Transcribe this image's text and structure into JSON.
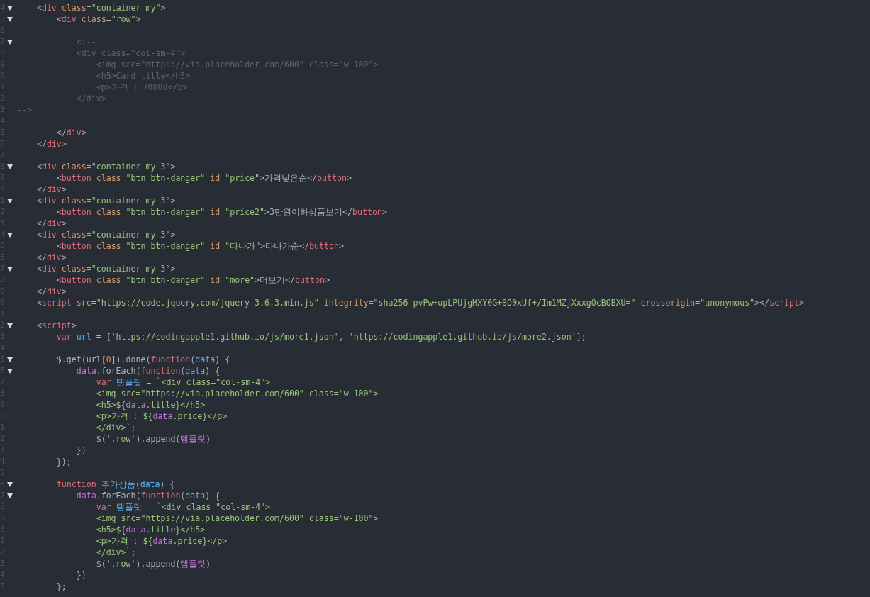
{
  "editor": {
    "lines": [
      {
        "gutter": "4",
        "fold": true,
        "tokens": [
          {
            "kind": "p",
            "text": "    <"
          },
          {
            "kind": "t",
            "text": "div"
          },
          {
            "kind": "a",
            "text": " class"
          },
          {
            "kind": "p",
            "text": "="
          },
          {
            "kind": "s",
            "text": "\"container my\""
          },
          {
            "kind": "p",
            "text": ">"
          }
        ]
      },
      {
        "gutter": "5",
        "fold": true,
        "tokens": [
          {
            "kind": "p",
            "text": "        <"
          },
          {
            "kind": "t",
            "text": "div"
          },
          {
            "kind": "a",
            "text": " class"
          },
          {
            "kind": "p",
            "text": "="
          },
          {
            "kind": "s",
            "text": "\"row\""
          },
          {
            "kind": "p",
            "text": ">"
          }
        ]
      },
      {
        "gutter": "6",
        "fold": false
      },
      {
        "gutter": "7",
        "fold": true,
        "tokens": [
          {
            "kind": "c",
            "text": "            <!--"
          }
        ]
      },
      {
        "gutter": "8",
        "fold": false,
        "tokens": [
          {
            "kind": "c",
            "text": "            <div class=\"col-sm-4\">"
          }
        ]
      },
      {
        "gutter": "9",
        "fold": false,
        "tokens": [
          {
            "kind": "c",
            "text": "                <img src=\"https://via.placeholder.com/600\" class=\"w-100\">"
          }
        ]
      },
      {
        "gutter": "0",
        "fold": false,
        "tokens": [
          {
            "kind": "c",
            "text": "                <h5>Card title</h5>"
          }
        ]
      },
      {
        "gutter": "1",
        "fold": false,
        "tokens": [
          {
            "kind": "c",
            "text": "                <p>가격 : 70000</p>"
          }
        ]
      },
      {
        "gutter": "2",
        "fold": false,
        "tokens": [
          {
            "kind": "c",
            "text": "            </div>"
          }
        ]
      },
      {
        "gutter": "3",
        "fold": false,
        "tokens": [
          {
            "kind": "c",
            "text": "-->"
          }
        ]
      },
      {
        "gutter": "4",
        "fold": false
      },
      {
        "gutter": "5",
        "fold": false,
        "tokens": [
          {
            "kind": "p",
            "text": "        </"
          },
          {
            "kind": "t",
            "text": "div"
          },
          {
            "kind": "p",
            "text": ">"
          }
        ]
      },
      {
        "gutter": "6",
        "fold": false,
        "tokens": [
          {
            "kind": "p",
            "text": "    </"
          },
          {
            "kind": "t",
            "text": "div"
          },
          {
            "kind": "p",
            "text": ">"
          }
        ]
      },
      {
        "gutter": "7",
        "fold": false
      },
      {
        "gutter": "8",
        "fold": true,
        "tokens": [
          {
            "kind": "p",
            "text": "    <"
          },
          {
            "kind": "t",
            "text": "div"
          },
          {
            "kind": "a",
            "text": " class"
          },
          {
            "kind": "p",
            "text": "="
          },
          {
            "kind": "s",
            "text": "\"container my-3\""
          },
          {
            "kind": "p",
            "text": ">"
          }
        ]
      },
      {
        "gutter": "9",
        "fold": false,
        "tokens": [
          {
            "kind": "p",
            "text": "        <"
          },
          {
            "kind": "t",
            "text": "button"
          },
          {
            "kind": "a",
            "text": " class"
          },
          {
            "kind": "p",
            "text": "="
          },
          {
            "kind": "s",
            "text": "\"btn btn-danger\""
          },
          {
            "kind": "a",
            "text": " id"
          },
          {
            "kind": "p",
            "text": "="
          },
          {
            "kind": "s",
            "text": "\"price\""
          },
          {
            "kind": "p",
            "text": ">가격낮은순</"
          },
          {
            "kind": "t",
            "text": "button"
          },
          {
            "kind": "p",
            "text": ">"
          }
        ]
      },
      {
        "gutter": "0",
        "fold": false,
        "tokens": [
          {
            "kind": "p",
            "text": "    </"
          },
          {
            "kind": "t",
            "text": "div"
          },
          {
            "kind": "p",
            "text": ">"
          }
        ]
      },
      {
        "gutter": "1",
        "fold": true,
        "tokens": [
          {
            "kind": "p",
            "text": "    <"
          },
          {
            "kind": "t",
            "text": "div"
          },
          {
            "kind": "a",
            "text": " class"
          },
          {
            "kind": "p",
            "text": "="
          },
          {
            "kind": "s",
            "text": "\"container my-3\""
          },
          {
            "kind": "p",
            "text": ">"
          }
        ]
      },
      {
        "gutter": "2",
        "fold": false,
        "tokens": [
          {
            "kind": "p",
            "text": "        <"
          },
          {
            "kind": "t",
            "text": "button"
          },
          {
            "kind": "a",
            "text": " class"
          },
          {
            "kind": "p",
            "text": "="
          },
          {
            "kind": "s",
            "text": "\"btn btn-danger\""
          },
          {
            "kind": "a",
            "text": " id"
          },
          {
            "kind": "p",
            "text": "="
          },
          {
            "kind": "s",
            "text": "\"price2\""
          },
          {
            "kind": "p",
            "text": ">3만원이하상품보기</"
          },
          {
            "kind": "t",
            "text": "button"
          },
          {
            "kind": "p",
            "text": ">"
          }
        ]
      },
      {
        "gutter": "3",
        "fold": false,
        "tokens": [
          {
            "kind": "p",
            "text": "    </"
          },
          {
            "kind": "t",
            "text": "div"
          },
          {
            "kind": "p",
            "text": ">"
          }
        ]
      },
      {
        "gutter": "4",
        "fold": true,
        "tokens": [
          {
            "kind": "p",
            "text": "    <"
          },
          {
            "kind": "t",
            "text": "div"
          },
          {
            "kind": "a",
            "text": " class"
          },
          {
            "kind": "p",
            "text": "="
          },
          {
            "kind": "s",
            "text": "\"container my-3\""
          },
          {
            "kind": "p",
            "text": ">"
          }
        ]
      },
      {
        "gutter": "5",
        "fold": false,
        "tokens": [
          {
            "kind": "p",
            "text": "        <"
          },
          {
            "kind": "t",
            "text": "button"
          },
          {
            "kind": "a",
            "text": " class"
          },
          {
            "kind": "p",
            "text": "="
          },
          {
            "kind": "s",
            "text": "\"btn btn-danger\""
          },
          {
            "kind": "a",
            "text": " id"
          },
          {
            "kind": "p",
            "text": "="
          },
          {
            "kind": "s",
            "text": "\"다나가\""
          },
          {
            "kind": "p",
            "text": ">다나가순</"
          },
          {
            "kind": "t",
            "text": "button"
          },
          {
            "kind": "p",
            "text": ">"
          }
        ]
      },
      {
        "gutter": "6",
        "fold": false,
        "tokens": [
          {
            "kind": "p",
            "text": "    </"
          },
          {
            "kind": "t",
            "text": "div"
          },
          {
            "kind": "p",
            "text": ">"
          }
        ]
      },
      {
        "gutter": "7",
        "fold": true,
        "tokens": [
          {
            "kind": "p",
            "text": "    <"
          },
          {
            "kind": "t",
            "text": "div"
          },
          {
            "kind": "a",
            "text": " class"
          },
          {
            "kind": "p",
            "text": "="
          },
          {
            "kind": "s",
            "text": "\"container my-3\""
          },
          {
            "kind": "p",
            "text": ">"
          }
        ]
      },
      {
        "gutter": "8",
        "fold": false,
        "tokens": [
          {
            "kind": "p",
            "text": "        <"
          },
          {
            "kind": "t",
            "text": "button"
          },
          {
            "kind": "a",
            "text": " class"
          },
          {
            "kind": "p",
            "text": "="
          },
          {
            "kind": "s",
            "text": "\"btn btn-danger\""
          },
          {
            "kind": "a",
            "text": " id"
          },
          {
            "kind": "p",
            "text": "="
          },
          {
            "kind": "s",
            "text": "\"more\""
          },
          {
            "kind": "p",
            "text": ">더보기</"
          },
          {
            "kind": "t",
            "text": "button"
          },
          {
            "kind": "p",
            "text": ">"
          }
        ]
      },
      {
        "gutter": "9",
        "fold": false,
        "tokens": [
          {
            "kind": "p",
            "text": "    </"
          },
          {
            "kind": "t",
            "text": "div"
          },
          {
            "kind": "p",
            "text": ">"
          }
        ]
      },
      {
        "gutter": "0",
        "fold": false,
        "tokens": [
          {
            "kind": "p",
            "text": "    <"
          },
          {
            "kind": "t",
            "text": "script"
          },
          {
            "kind": "a",
            "text": " src"
          },
          {
            "kind": "p",
            "text": "="
          },
          {
            "kind": "s",
            "text": "\"https://code.jquery.com/jquery-3.6.3.min.js\""
          },
          {
            "kind": "a",
            "text": " integrity"
          },
          {
            "kind": "p",
            "text": "="
          },
          {
            "kind": "s",
            "text": "\"sha256-pvPw+upLPUjgMXY0G+8O0xUf+/Im1MZjXxxgOcBQBXU=\""
          },
          {
            "kind": "a",
            "text": " crossorigin"
          },
          {
            "kind": "p",
            "text": "="
          },
          {
            "kind": "s",
            "text": "\"anonymous\""
          },
          {
            "kind": "p",
            "text": "></"
          },
          {
            "kind": "t",
            "text": "script"
          },
          {
            "kind": "p",
            "text": ">"
          }
        ]
      },
      {
        "gutter": "1",
        "fold": false
      },
      {
        "gutter": "2",
        "fold": true,
        "tokens": [
          {
            "kind": "p",
            "text": "    <"
          },
          {
            "kind": "t",
            "text": "script"
          },
          {
            "kind": "p",
            "text": ">"
          }
        ]
      },
      {
        "gutter": "3",
        "fold": false,
        "tokens": [
          {
            "kind": "k",
            "text": "        var"
          },
          {
            "kind": "v",
            "text": " url"
          },
          {
            "kind": "p",
            "text": " = ["
          },
          {
            "kind": "s",
            "text": "'https://codingapple1.github.io/js/more1.json'"
          },
          {
            "kind": "p",
            "text": ","
          },
          {
            "kind": "s",
            "text": " 'https://codingapple1.github.io/js/more2.json'"
          },
          {
            "kind": "p",
            "text": "];"
          }
        ]
      },
      {
        "gutter": "4",
        "fold": false
      },
      {
        "gutter": "5",
        "fold": true,
        "tokens": [
          {
            "kind": "p",
            "text": "        $.get(url["
          },
          {
            "kind": "n",
            "text": "0"
          },
          {
            "kind": "p",
            "text": "]).done("
          },
          {
            "kind": "k",
            "text": "function"
          },
          {
            "kind": "p",
            "text": "("
          },
          {
            "kind": "v",
            "text": "data"
          },
          {
            "kind": "p",
            "text": ") {"
          }
        ]
      },
      {
        "gutter": "6",
        "fold": true,
        "tokens": [
          {
            "kind": "m",
            "text": "            data"
          },
          {
            "kind": "p",
            "text": ".forEach("
          },
          {
            "kind": "k",
            "text": "function"
          },
          {
            "kind": "p",
            "text": "("
          },
          {
            "kind": "v",
            "text": "data"
          },
          {
            "kind": "p",
            "text": ") {"
          }
        ]
      },
      {
        "gutter": "7",
        "fold": false,
        "tokens": [
          {
            "kind": "k",
            "text": "                var"
          },
          {
            "kind": "v",
            "text": " 템플릿"
          },
          {
            "kind": "p",
            "text": " ="
          },
          {
            "kind": "s",
            "text": " `<div class=\"col-sm-4\">"
          }
        ]
      },
      {
        "gutter": "8",
        "fold": false,
        "tokens": [
          {
            "kind": "s",
            "text": "                <img src=\"https://via.placeholder.com/600\" class=\"w-100\">"
          }
        ]
      },
      {
        "gutter": "9",
        "fold": false,
        "tokens": [
          {
            "kind": "s",
            "text": "                <h5>${"
          },
          {
            "kind": "m",
            "text": "data"
          },
          {
            "kind": "s",
            "text": ".title}</h5>"
          }
        ]
      },
      {
        "gutter": "0",
        "fold": false,
        "tokens": [
          {
            "kind": "s",
            "text": "                <p>가격 : ${"
          },
          {
            "kind": "m",
            "text": "data"
          },
          {
            "kind": "s",
            "text": ".price}</p>"
          }
        ]
      },
      {
        "gutter": "1",
        "fold": false,
        "tokens": [
          {
            "kind": "s",
            "text": "                </div>`"
          },
          {
            "kind": "p",
            "text": ";"
          }
        ]
      },
      {
        "gutter": "2",
        "fold": false,
        "tokens": [
          {
            "kind": "p",
            "text": "                $("
          },
          {
            "kind": "s",
            "text": "'.row'"
          },
          {
            "kind": "p",
            "text": ").append("
          },
          {
            "kind": "m",
            "text": "템플릿"
          },
          {
            "kind": "p",
            "text": ")"
          }
        ]
      },
      {
        "gutter": "3",
        "fold": false,
        "tokens": [
          {
            "kind": "p",
            "text": "            })"
          }
        ]
      },
      {
        "gutter": "4",
        "fold": false,
        "tokens": [
          {
            "kind": "p",
            "text": "        });"
          }
        ]
      },
      {
        "gutter": "5",
        "fold": false
      },
      {
        "gutter": "6",
        "fold": true,
        "tokens": [
          {
            "kind": "k",
            "text": "        function"
          },
          {
            "kind": "v",
            "text": " 추가상품"
          },
          {
            "kind": "p",
            "text": "("
          },
          {
            "kind": "v",
            "text": "data"
          },
          {
            "kind": "p",
            "text": ") {"
          }
        ]
      },
      {
        "gutter": "7",
        "fold": true,
        "tokens": [
          {
            "kind": "m",
            "text": "            data"
          },
          {
            "kind": "p",
            "text": ".forEach("
          },
          {
            "kind": "k",
            "text": "function"
          },
          {
            "kind": "p",
            "text": "("
          },
          {
            "kind": "v",
            "text": "data"
          },
          {
            "kind": "p",
            "text": ") {"
          }
        ]
      },
      {
        "gutter": "8",
        "fold": false,
        "tokens": [
          {
            "kind": "k",
            "text": "                var"
          },
          {
            "kind": "v",
            "text": " 템플릿"
          },
          {
            "kind": "p",
            "text": " ="
          },
          {
            "kind": "s",
            "text": " `<div class=\"col-sm-4\">"
          }
        ]
      },
      {
        "gutter": "9",
        "fold": false,
        "tokens": [
          {
            "kind": "s",
            "text": "                <img src=\"https://via.placeholder.com/600\" class=\"w-100\">"
          }
        ]
      },
      {
        "gutter": "0",
        "fold": false,
        "tokens": [
          {
            "kind": "s",
            "text": "                <h5>${"
          },
          {
            "kind": "m",
            "text": "data"
          },
          {
            "kind": "s",
            "text": ".title}</h5>"
          }
        ]
      },
      {
        "gutter": "1",
        "fold": false,
        "tokens": [
          {
            "kind": "s",
            "text": "                <p>가격 : ${"
          },
          {
            "kind": "m",
            "text": "data"
          },
          {
            "kind": "s",
            "text": ".price}</p>"
          }
        ]
      },
      {
        "gutter": "2",
        "fold": false,
        "tokens": [
          {
            "kind": "s",
            "text": "                </div>`"
          },
          {
            "kind": "p",
            "text": ";"
          }
        ]
      },
      {
        "gutter": "3",
        "fold": false,
        "tokens": [
          {
            "kind": "p",
            "text": "                $("
          },
          {
            "kind": "s",
            "text": "'.row'"
          },
          {
            "kind": "p",
            "text": ").append("
          },
          {
            "kind": "m",
            "text": "템플릿"
          },
          {
            "kind": "p",
            "text": ")"
          }
        ]
      },
      {
        "gutter": "4",
        "fold": false,
        "tokens": [
          {
            "kind": "p",
            "text": "            })"
          }
        ]
      },
      {
        "gutter": "5",
        "fold": false,
        "tokens": [
          {
            "kind": "p",
            "text": "        };"
          }
        ]
      }
    ]
  }
}
